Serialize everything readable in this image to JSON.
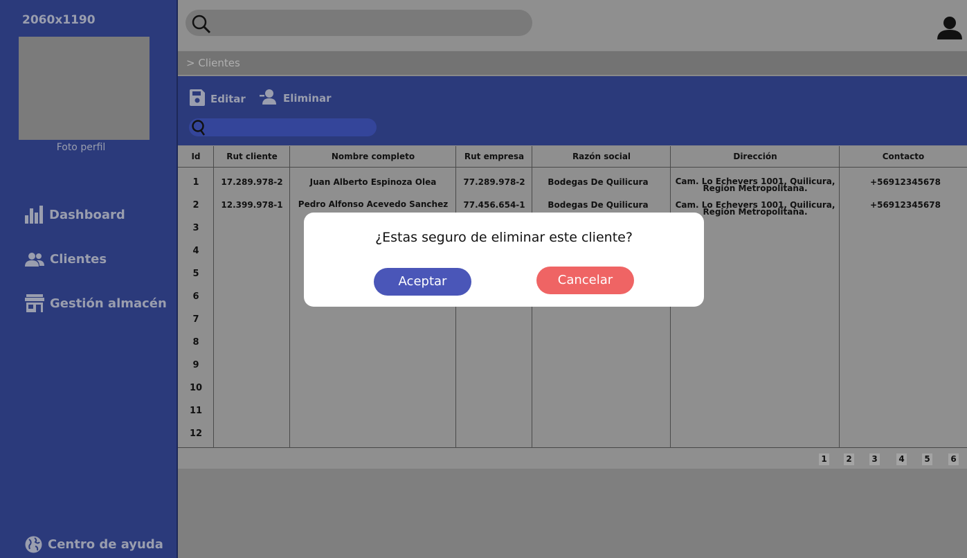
{
  "sidebar": {
    "dims": "2060x1190",
    "photo_label": "Foto perfil",
    "items": [
      {
        "label": "Dashboard"
      },
      {
        "label": "Clientes"
      },
      {
        "label": "Gestión almacén"
      }
    ],
    "help_label": "Centro de ayuda"
  },
  "breadcrumb": "> Clientes",
  "toolbar": {
    "edit_label": "Editar",
    "delete_label": "Eliminar"
  },
  "table": {
    "headers": [
      "Id",
      "Rut cliente",
      "Nombre completo",
      "Rut empresa",
      "Razón social",
      "Dirección",
      "Contacto"
    ],
    "rows": [
      {
        "id": "1",
        "rut_cliente": "17.289.978-2",
        "nombre": "Juan Alberto Espinoza Olea",
        "rut_empresa": "77.289.978-2",
        "razon": "Bodegas De Quilicura",
        "direccion_1": "Cam. Lo Echevers 1001, Quilicura,",
        "direccion_2": "Región Metropolitana.",
        "contacto": "+56912345678"
      },
      {
        "id": "2",
        "rut_cliente": "12.399.978-1",
        "nombre": "Pedro Alfonso Acevedo Sanchez",
        "rut_empresa": "77.456.654-1",
        "razon": "Bodegas De Quilicura",
        "direccion_1": "Cam. Lo Echevers 1001, Quilicura,",
        "direccion_2": "Región Metropolitana.",
        "contacto": "+56912345678"
      }
    ],
    "ids": [
      "1",
      "2",
      "3",
      "4",
      "5",
      "6",
      "7",
      "8",
      "9",
      "10",
      "11",
      "12"
    ]
  },
  "pagination": [
    "1",
    "2",
    "3",
    "4",
    "5",
    "6"
  ],
  "modal": {
    "message": "¿Estas seguro de eliminar este cliente?",
    "accept_label": "Aceptar",
    "cancel_label": "Cancelar"
  },
  "colors": {
    "sidebar": "#2b3a7b",
    "accept": "#4a56b8",
    "cancel": "#ef6464"
  }
}
